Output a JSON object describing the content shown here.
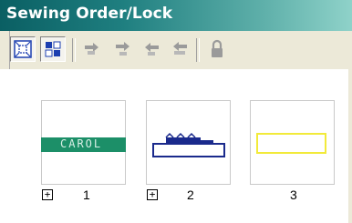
{
  "window": {
    "title": "Sewing Order/Lock"
  },
  "toolbar": {
    "buttons": [
      {
        "icon": "frame-select-icon",
        "state": "pressed"
      },
      {
        "icon": "order-sort-icon",
        "state": "normal"
      },
      {
        "icon": "move-first-icon",
        "state": "disabled"
      },
      {
        "icon": "move-back-icon",
        "state": "disabled"
      },
      {
        "icon": "move-forward-icon",
        "state": "disabled"
      },
      {
        "icon": "move-last-icon",
        "state": "disabled"
      },
      {
        "icon": "lock-icon",
        "state": "disabled"
      }
    ]
  },
  "items": [
    {
      "number": "1",
      "expand": "+",
      "content": "CAROL"
    },
    {
      "number": "2",
      "expand": "+",
      "content": ""
    },
    {
      "number": "3",
      "expand": "",
      "content": ""
    }
  ],
  "colors": {
    "title_bar_start": "#0a5f63",
    "title_bar_end": "#8fd2c9",
    "carol_fill": "#1c8f68",
    "navy_outline": "#1a2a8c",
    "yellow_outline": "#f2ea3a"
  }
}
